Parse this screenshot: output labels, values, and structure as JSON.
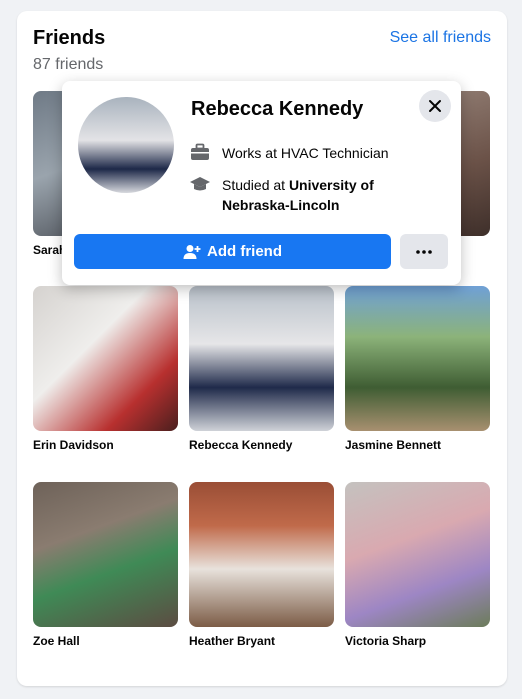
{
  "friends_card": {
    "title": "Friends",
    "count": "87 friends",
    "see_all": "See all friends"
  },
  "friends": [
    {
      "name": "Sarah"
    },
    {
      "name": ""
    },
    {
      "name": ""
    },
    {
      "name": "Erin Davidson"
    },
    {
      "name": "Rebecca Kennedy"
    },
    {
      "name": "Jasmine Bennett"
    },
    {
      "name": "Zoe Hall"
    },
    {
      "name": "Heather Bryant"
    },
    {
      "name": "Victoria Sharp"
    }
  ],
  "popup": {
    "name": "Rebecca Kennedy",
    "work": "Works at HVAC Technician",
    "study_prefix": "Studied at ",
    "study_school_line1": "University of",
    "study_school_line2": "Nebraska-Lincoln",
    "add_friend": "Add friend"
  },
  "icons": {
    "close": "close-icon",
    "work": "briefcase-icon",
    "study": "graduation-cap-icon",
    "add": "add-friend-icon",
    "more": "more-options-icon"
  },
  "colors": {
    "accent": "#1877f2",
    "link": "#1b74e4",
    "secondary_text": "#65676b",
    "button_grey": "#e4e6eb"
  }
}
